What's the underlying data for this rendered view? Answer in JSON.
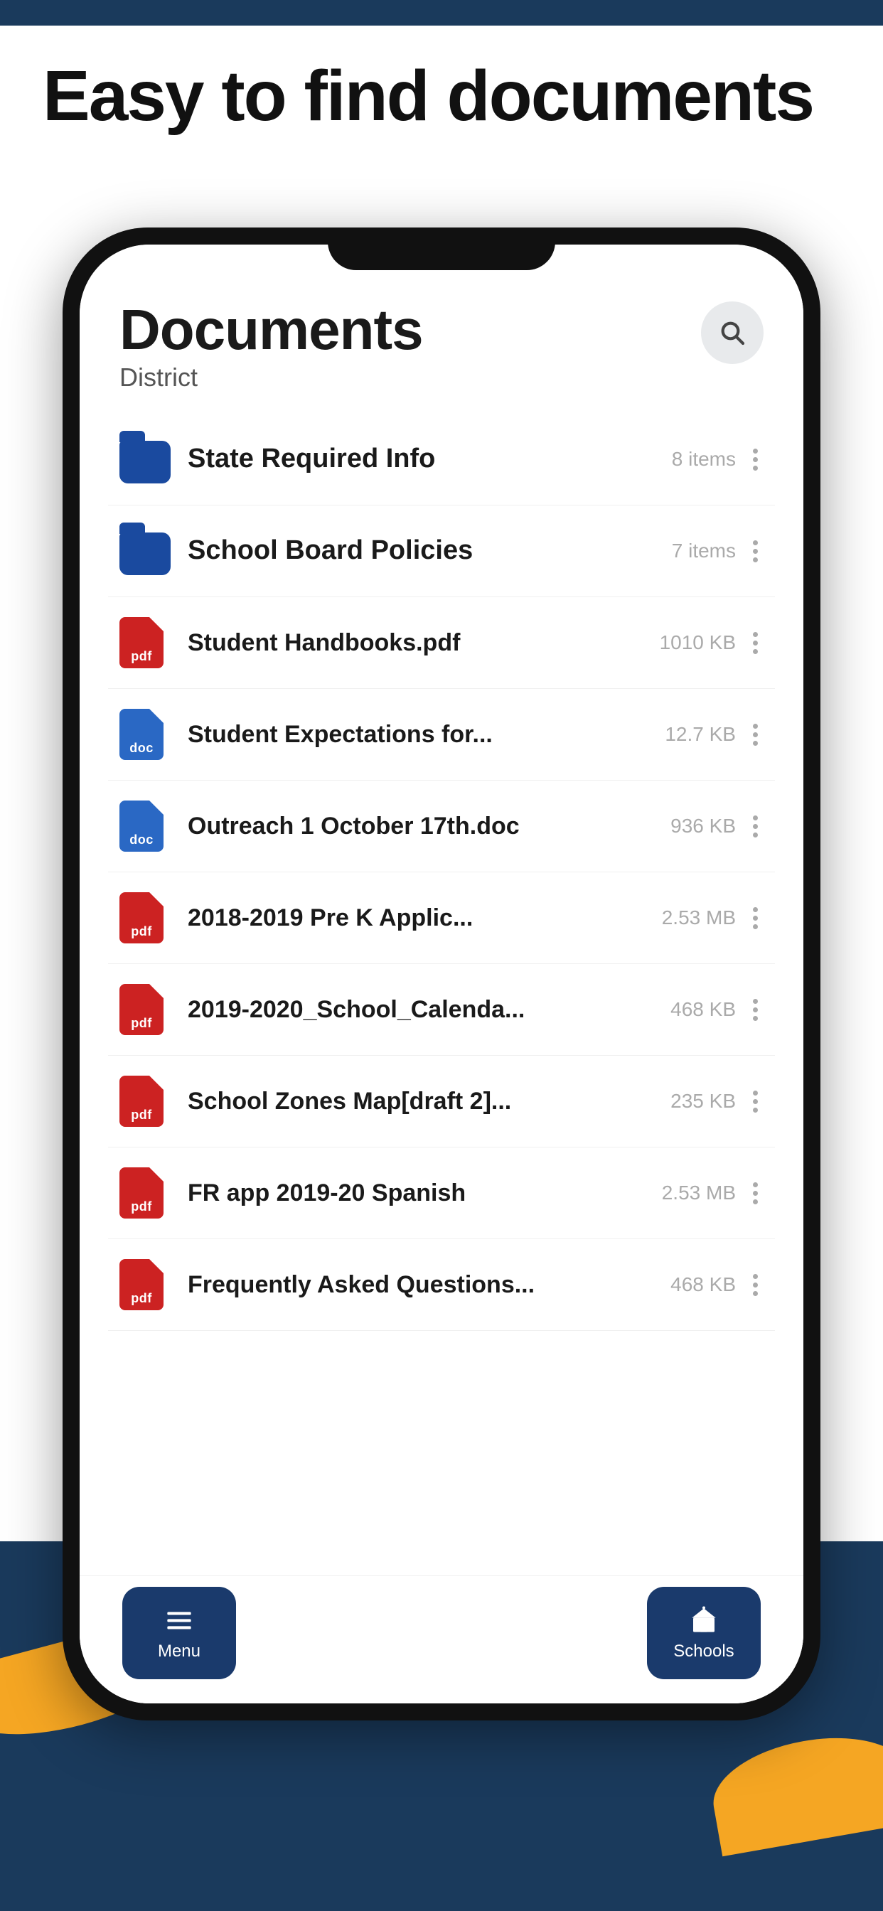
{
  "page": {
    "headline": "Easy to find documents",
    "bg_top_color": "#1a3a5c",
    "bg_bottom_color": "#1a3a5c",
    "accent_color": "#f5a623"
  },
  "screen": {
    "title": "Documents",
    "subtitle": "District",
    "search_icon": "search-icon"
  },
  "documents": [
    {
      "id": 1,
      "type": "folder",
      "name": "State Required Info",
      "meta": "8 items"
    },
    {
      "id": 2,
      "type": "folder",
      "name": "School Board Policies",
      "meta": "7 items"
    },
    {
      "id": 3,
      "type": "pdf",
      "name": "Student Handbooks.pdf",
      "meta": "1010 KB"
    },
    {
      "id": 4,
      "type": "doc",
      "name": "Student Expectations for...",
      "meta": "12.7 KB"
    },
    {
      "id": 5,
      "type": "doc",
      "name": "Outreach 1 October 17th.doc",
      "meta": "936 KB"
    },
    {
      "id": 6,
      "type": "pdf",
      "name": "2018-2019 Pre K Applic...",
      "meta": "2.53 MB"
    },
    {
      "id": 7,
      "type": "pdf",
      "name": "2019-2020_School_Calenda...",
      "meta": "468 KB"
    },
    {
      "id": 8,
      "type": "pdf",
      "name": "School Zones Map[draft 2]...",
      "meta": "235 KB"
    },
    {
      "id": 9,
      "type": "pdf",
      "name": "FR app 2019-20 Spanish",
      "meta": "2.53 MB"
    },
    {
      "id": 10,
      "type": "pdf",
      "name": "Frequently Asked Questions...",
      "meta": "468 KB"
    }
  ],
  "tabs": [
    {
      "id": "menu",
      "label": "Menu",
      "icon": "menu-icon",
      "active": false
    },
    {
      "id": "schools",
      "label": "Schools",
      "icon": "schools-icon",
      "active": true
    }
  ]
}
